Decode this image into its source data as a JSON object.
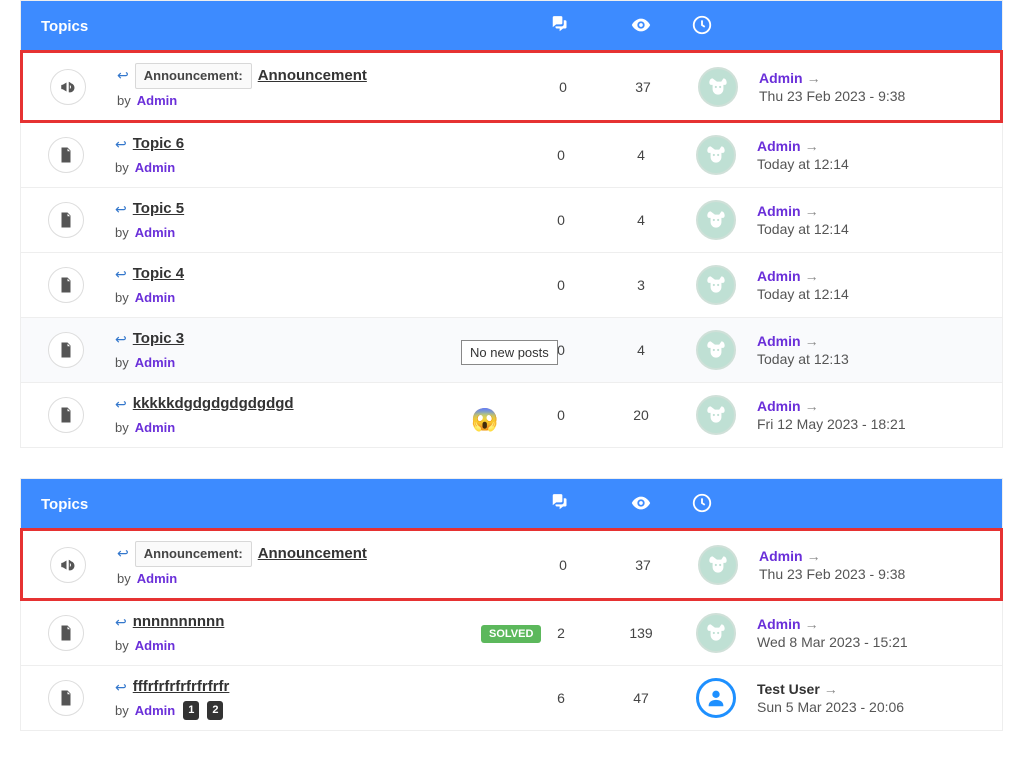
{
  "header": {
    "topics_label": "Topics",
    "tooltip": "No new posts"
  },
  "labels": {
    "by": "by",
    "announcement": "Announcement:",
    "solved": "SOLVED"
  },
  "sections": [
    {
      "rows": [
        {
          "icon": "megaphone",
          "highlighted": true,
          "shaded": false,
          "announcement": true,
          "title": "Announcement",
          "author": "Admin",
          "replies": 0,
          "views": 37,
          "last_author": "Admin",
          "last_date": "Thu 23 Feb 2023 - 9:38",
          "avatar": "dog"
        },
        {
          "icon": "doc",
          "highlighted": false,
          "shaded": false,
          "announcement": false,
          "title": "Topic 6",
          "author": "Admin",
          "replies": 0,
          "views": 4,
          "last_author": "Admin",
          "last_date": "Today at 12:14",
          "avatar": "dog"
        },
        {
          "icon": "doc",
          "highlighted": false,
          "shaded": false,
          "announcement": false,
          "title": "Topic 5",
          "author": "Admin",
          "replies": 0,
          "views": 4,
          "last_author": "Admin",
          "last_date": "Today at 12:14",
          "avatar": "dog"
        },
        {
          "icon": "doc",
          "highlighted": false,
          "shaded": false,
          "announcement": false,
          "title": "Topic 4",
          "author": "Admin",
          "replies": 0,
          "views": 3,
          "last_author": "Admin",
          "last_date": "Today at 12:14",
          "avatar": "dog"
        },
        {
          "icon": "doc",
          "highlighted": false,
          "shaded": true,
          "announcement": false,
          "title": "Topic 3",
          "author": "Admin",
          "replies": 0,
          "views": 4,
          "last_author": "Admin",
          "last_date": "Today at 12:13",
          "avatar": "dog",
          "tooltip": true
        },
        {
          "icon": "doc",
          "highlighted": false,
          "shaded": false,
          "announcement": false,
          "title": "kkkkkdgdgdgdgdgdgd",
          "author": "Admin",
          "replies": 0,
          "views": 20,
          "last_author": "Admin",
          "last_date": "Fri 12 May 2023 - 18:21",
          "avatar": "dog",
          "emoji": "😱"
        }
      ]
    },
    {
      "rows": [
        {
          "icon": "megaphone",
          "highlighted": true,
          "shaded": false,
          "announcement": true,
          "title": "Announcement",
          "author": "Admin",
          "replies": 0,
          "views": 37,
          "last_author": "Admin",
          "last_date": "Thu 23 Feb 2023 - 9:38",
          "avatar": "dog"
        },
        {
          "icon": "doc",
          "highlighted": false,
          "shaded": false,
          "announcement": false,
          "title": "nnnnnnnnnn",
          "author": "Admin",
          "replies": 2,
          "views": 139,
          "last_author": "Admin",
          "last_date": "Wed 8 Mar 2023 - 15:21",
          "avatar": "dog",
          "solved": true
        },
        {
          "icon": "doc",
          "highlighted": false,
          "shaded": false,
          "announcement": false,
          "title": "fffrfrfrfrfrfrfrfr",
          "author": "Admin",
          "replies": 6,
          "views": 47,
          "last_author": "Test User",
          "last_author_is_admin": false,
          "last_date": "Sun 5 Mar 2023 - 20:06",
          "avatar": "user",
          "pages": [
            1,
            2
          ]
        }
      ]
    }
  ]
}
